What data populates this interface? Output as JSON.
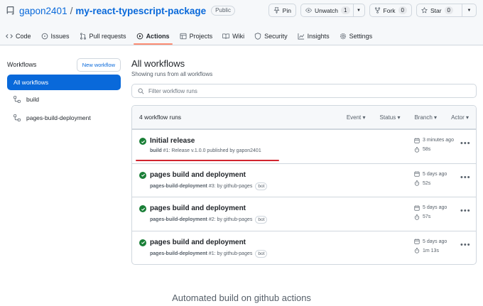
{
  "repo": {
    "owner": "gapon2401",
    "separator": "/",
    "name": "my-react-typescript-package",
    "visibility": "Public"
  },
  "header_buttons": {
    "pin": "Pin",
    "unwatch": "Unwatch",
    "unwatch_count": "1",
    "fork": "Fork",
    "fork_count": "0",
    "star": "Star",
    "star_count": "0"
  },
  "tabs": [
    {
      "label": "Code",
      "icon": "code-icon"
    },
    {
      "label": "Issues",
      "icon": "issue-icon"
    },
    {
      "label": "Pull requests",
      "icon": "pull-request-icon"
    },
    {
      "label": "Actions",
      "icon": "play-icon",
      "selected": true
    },
    {
      "label": "Projects",
      "icon": "table-icon"
    },
    {
      "label": "Wiki",
      "icon": "book-icon"
    },
    {
      "label": "Security",
      "icon": "shield-icon"
    },
    {
      "label": "Insights",
      "icon": "graph-icon"
    },
    {
      "label": "Settings",
      "icon": "gear-icon"
    }
  ],
  "sidebar": {
    "title": "Workflows",
    "new_button": "New workflow",
    "items": [
      {
        "label": "All workflows",
        "selected": true
      },
      {
        "label": "build",
        "icon": "workflow-icon"
      },
      {
        "label": "pages-build-deployment",
        "icon": "workflow-icon"
      }
    ]
  },
  "main": {
    "title": "All workflows",
    "subtitle": "Showing runs from all workflows",
    "filter_placeholder": "Filter workflow runs",
    "run_count": "4 workflow runs",
    "filters": [
      "Event",
      "Status",
      "Branch",
      "Actor"
    ],
    "runs": [
      {
        "title": "Initial release",
        "workflow": "build",
        "number": "#1",
        "desc": ": Release v.1.0.0 published by gapon2401",
        "bot": "",
        "time": "3 minutes ago",
        "duration": "58s",
        "status": "success"
      },
      {
        "title": "pages build and deployment",
        "workflow": "pages-build-deployment",
        "number": "#3",
        "desc": ": by github-pages",
        "bot": "bot",
        "time": "5 days ago",
        "duration": "52s",
        "status": "success"
      },
      {
        "title": "pages build and deployment",
        "workflow": "pages-build-deployment",
        "number": "#2",
        "desc": ": by github-pages",
        "bot": "bot",
        "time": "5 days ago",
        "duration": "57s",
        "status": "success"
      },
      {
        "title": "pages build and deployment",
        "workflow": "pages-build-deployment",
        "number": "#1",
        "desc": ": by github-pages",
        "bot": "bot",
        "time": "5 days ago",
        "duration": "1m 13s",
        "status": "success"
      }
    ]
  },
  "caption": "Automated build on github actions",
  "colors": {
    "accent": "#0969da",
    "success": "#1a7f37",
    "tab_underline": "#fd8c73",
    "annotation": "#d1242f"
  }
}
